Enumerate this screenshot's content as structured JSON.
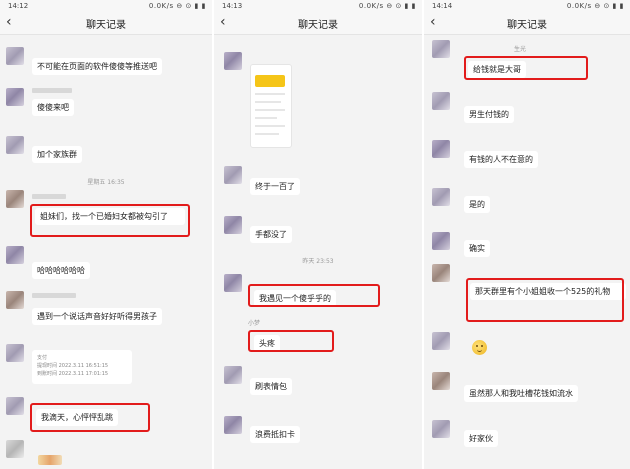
{
  "panels": [
    {
      "status_time": "14:12",
      "status_right": "0.0K/s ⊖ ⊙ ▮ ▮",
      "title": "聊天记录",
      "messages": [
        "不可能在页面的软件傻傻等推送吧",
        "傻傻来吧",
        "加个家族群",
        "姐妹们，找一个已婚妇女都被勾引了",
        "哈哈哈哈哈哈",
        "遇到一个说话声音好好听得男孩子",
        "我滴天，心怦怦乱跳"
      ],
      "timestamp": "星期五 16:35",
      "card_rows": [
        "支付",
        "提现时间    2022.3.11  16:51:15",
        "到账时间    2022.3.11  17:01:15"
      ]
    },
    {
      "status_time": "14:13",
      "status_right": "0.0K/s ⊖ ⊙ ▮ ▮",
      "title": "聊天记录",
      "messages": [
        "终于一百了",
        "手都没了",
        "我遇见一个傻乎乎的",
        "头疼",
        "刷表情包",
        "浪费抵扣卡"
      ],
      "timestamp": "昨天 23:53",
      "sender": "小梦"
    },
    {
      "status_time": "14:14",
      "status_right": "0.0K/s ⊖ ⊙ ▮ ▮",
      "title": "聊天记录",
      "messages": [
        "给钱就是大哥",
        "男生付钱的",
        "有钱的人不在意的",
        "是的",
        "确实",
        "那天群里有个小姐姐收一个525的礼物",
        "虽然那人和我吐槽花钱如流水",
        "好家伙"
      ],
      "top_fragment": "生光"
    }
  ]
}
